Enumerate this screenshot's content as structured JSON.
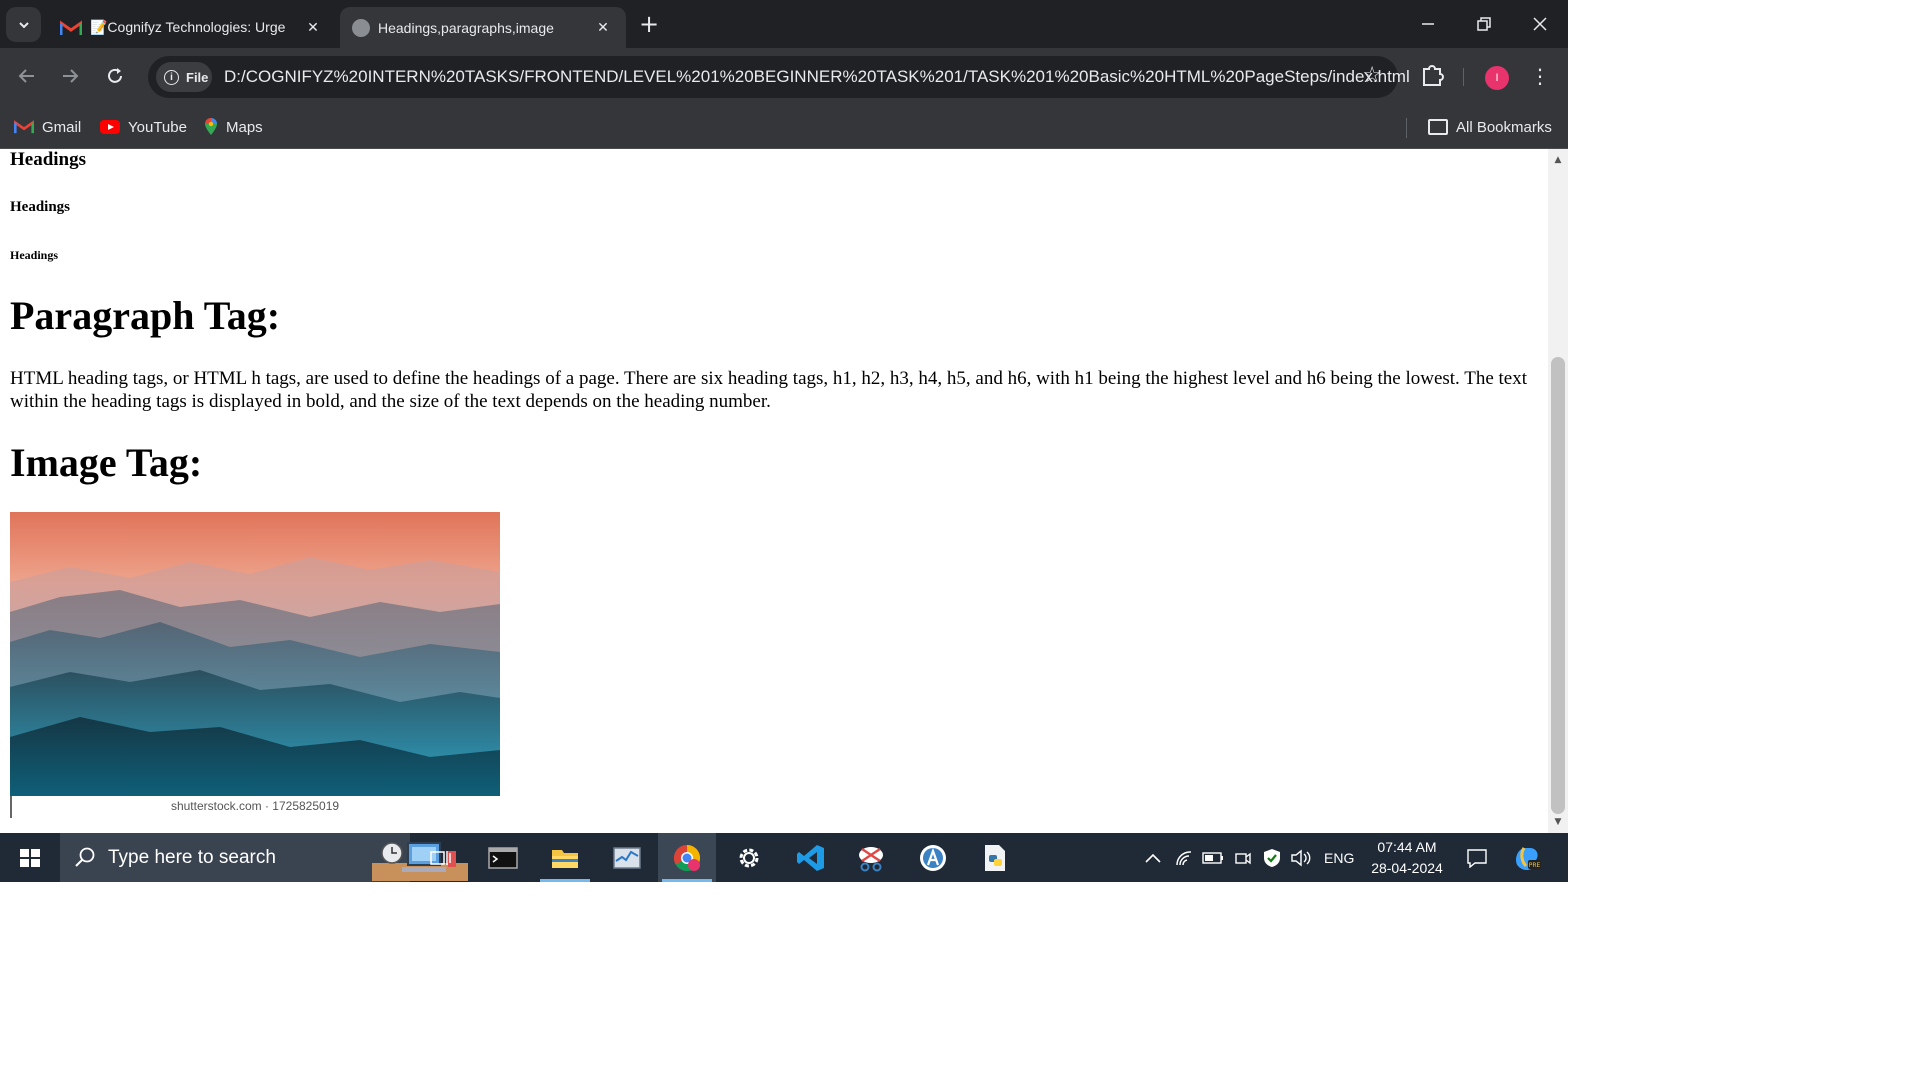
{
  "browser": {
    "tabs": [
      {
        "title": "📝Cognifyz Technologies: Urge",
        "icon": "gmail-icon"
      },
      {
        "title": "Headings,paragraphs,image",
        "icon": "globe-icon"
      }
    ],
    "site_chip_label": "File",
    "url": "D:/COGNIFYZ%20INTERN%20TASKS/FRONTEND/LEVEL%201%20BEGINNER%20TASK%201/TASK%201%20Basic%20HTML%20PageSteps/index.html",
    "profile_initial": "I",
    "bookmarks": [
      {
        "label": "Gmail",
        "icon": "gmail-icon"
      },
      {
        "label": "YouTube",
        "icon": "youtube-icon"
      },
      {
        "label": "Maps",
        "icon": "maps-icon"
      }
    ],
    "all_bookmarks_label": "All Bookmarks"
  },
  "page": {
    "heading4": "Headings",
    "heading5": "Headings",
    "heading6": "Headings",
    "paragraph_heading": "Paragraph Tag:",
    "paragraph_text": "HTML heading tags, or HTML h tags, are used to define the headings of a page. There are six heading tags, h1, h2, h3, h4, h5, and h6, with h1 being the highest level and h6 being the lowest. The text within the heading tags is displayed in bold, and the size of the text depends on the heading number.",
    "image_heading": "Image Tag:",
    "image_caption": "shutterstock.com · 1725825019"
  },
  "taskbar": {
    "search_placeholder": "Type here to search",
    "language": "ENG",
    "time": "07:44 AM",
    "date": "28-04-2024"
  },
  "colors": {
    "tab_strip": "#202124",
    "toolbar": "#35363a",
    "taskbar": "#1f2a36",
    "profile": "#e8336d"
  }
}
